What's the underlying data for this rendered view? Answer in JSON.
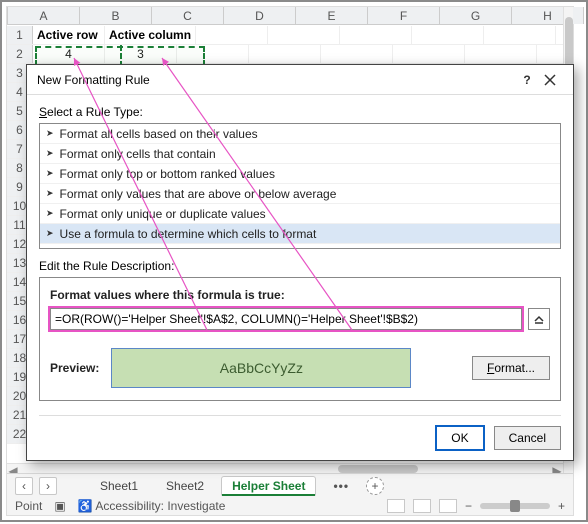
{
  "grid": {
    "columns": [
      "A",
      "B",
      "C",
      "D",
      "E",
      "F",
      "G",
      "H"
    ],
    "row_labels": [
      "1",
      "2",
      "3",
      "4",
      "5",
      "6",
      "7",
      "8",
      "9",
      "10",
      "11",
      "12",
      "13",
      "14",
      "15",
      "16",
      "17",
      "18",
      "19",
      "20",
      "21",
      "22"
    ],
    "header_row": {
      "A": "Active row",
      "B": "Active column"
    },
    "data_row": {
      "A": "4",
      "B": "3"
    }
  },
  "dialog": {
    "title": "New Formatting Rule",
    "help": "?",
    "select_label_pre": "S",
    "select_label_rest": "elect a Rule Type:",
    "rule_types": [
      "Format all cells based on their values",
      "Format only cells that contain",
      "Format only top or bottom ranked values",
      "Format only values that are above or below average",
      "Format only unique or duplicate values",
      "Use a formula to determine which cells to format"
    ],
    "edit_label": "Edit the Rule Description:",
    "formula_label": "Format values where this formula is true:",
    "formula_value": "=OR(ROW()='Helper Sheet'!$A$2, COLUMN()='Helper Sheet'!$B$2)",
    "preview_label": "Preview:",
    "preview_sample": "AaBbCcYyZz",
    "format_btn_pre": "F",
    "format_btn_rest": "ormat...",
    "ok": "OK",
    "cancel": "Cancel"
  },
  "tabs": {
    "prev": "‹",
    "next": "›",
    "items": [
      "Sheet1",
      "Sheet2",
      "Helper Sheet"
    ],
    "active_index": 2,
    "more": "•••",
    "add": "+"
  },
  "status": {
    "mode": "Point",
    "access": "Accessibility: Investigate",
    "minus": "−",
    "plus": "+"
  },
  "chart_data": {
    "type": "table",
    "columns": [
      "Active row",
      "Active column"
    ],
    "rows": [
      [
        4,
        3
      ]
    ]
  }
}
